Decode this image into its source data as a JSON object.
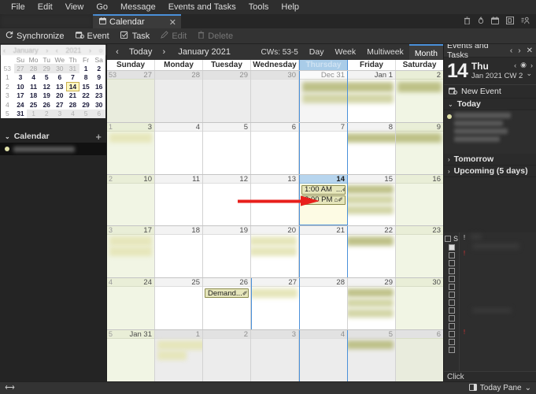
{
  "menubar": {
    "items": [
      {
        "label": "File"
      },
      {
        "label": "Edit"
      },
      {
        "label": "View"
      },
      {
        "label": "Go"
      },
      {
        "label": "Message"
      },
      {
        "label": "Events and Tasks"
      },
      {
        "label": "Tools"
      },
      {
        "label": "Help"
      }
    ]
  },
  "tabbar": {
    "tab_label": "Calendar",
    "tab_icon": "calendar-icon",
    "close_label": "✕",
    "icons": [
      "trash-icon",
      "fire-icon",
      "calendar-icon",
      "calendar-box-icon",
      "contacts-icon"
    ]
  },
  "toolbar": {
    "synchronize": "Synchronize",
    "event": "Event",
    "task": "Task",
    "edit": "Edit",
    "delete": "Delete"
  },
  "minicalendar": {
    "header_prev": "‹",
    "header_month": "January",
    "header_next": "›",
    "header_prev_y": "‹",
    "header_year": "2021",
    "header_next_y": "›",
    "header_dot": "○",
    "weekday_headers": [
      "Su",
      "Mo",
      "Tu",
      "We",
      "Th",
      "Fr",
      "Sa"
    ],
    "rows": [
      {
        "week": "53",
        "days": [
          {
            "n": "27",
            "o": true
          },
          {
            "n": "28",
            "o": true
          },
          {
            "n": "29",
            "o": true
          },
          {
            "n": "30",
            "o": true
          },
          {
            "n": "31",
            "o": true
          },
          {
            "n": "1"
          },
          {
            "n": "2"
          }
        ],
        "offmonth": true
      },
      {
        "week": "1",
        "days": [
          {
            "n": "3"
          },
          {
            "n": "4"
          },
          {
            "n": "5"
          },
          {
            "n": "6"
          },
          {
            "n": "7"
          },
          {
            "n": "8"
          },
          {
            "n": "9"
          }
        ]
      },
      {
        "week": "2",
        "days": [
          {
            "n": "10"
          },
          {
            "n": "11"
          },
          {
            "n": "12"
          },
          {
            "n": "13"
          },
          {
            "n": "14",
            "today": true
          },
          {
            "n": "15"
          },
          {
            "n": "16"
          }
        ]
      },
      {
        "week": "3",
        "days": [
          {
            "n": "17"
          },
          {
            "n": "18"
          },
          {
            "n": "19"
          },
          {
            "n": "20"
          },
          {
            "n": "21"
          },
          {
            "n": "22"
          },
          {
            "n": "23"
          }
        ]
      },
      {
        "week": "4",
        "days": [
          {
            "n": "24"
          },
          {
            "n": "25"
          },
          {
            "n": "26"
          },
          {
            "n": "27"
          },
          {
            "n": "28"
          },
          {
            "n": "29"
          },
          {
            "n": "30"
          }
        ]
      },
      {
        "week": "5",
        "days": [
          {
            "n": "31"
          },
          {
            "n": "1",
            "o": true
          },
          {
            "n": "2",
            "o": true
          },
          {
            "n": "3",
            "o": true
          },
          {
            "n": "4",
            "o": true
          },
          {
            "n": "5",
            "o": true
          },
          {
            "n": "6",
            "o": true
          }
        ],
        "tailoff": true
      }
    ]
  },
  "sidebar": {
    "calendar_section_label": "Calendar",
    "add_label": "+",
    "collapse_caret": "⌄"
  },
  "calendar": {
    "prev": "‹",
    "today_label": "Today",
    "next": "›",
    "month_label": "January 2021",
    "cws_label": "CWs: 53-5",
    "views": [
      {
        "label": "Day",
        "active": false
      },
      {
        "label": "Week",
        "active": false
      },
      {
        "label": "Multiweek",
        "active": false
      },
      {
        "label": "Month",
        "active": true
      }
    ],
    "day_headers": [
      "Sunday",
      "Monday",
      "Tuesday",
      "Wednesday",
      "Thursday",
      "Friday",
      "Saturday"
    ],
    "selected_day_header": "Thursday",
    "weeks": [
      {
        "week": "53",
        "cells": [
          {
            "num": "27",
            "offmonth": true,
            "weekend": true
          },
          {
            "num": "28",
            "offmonth": true
          },
          {
            "num": "29",
            "offmonth": true
          },
          {
            "num": "30",
            "offmonth": true
          },
          {
            "num": "Dec 31",
            "offmonth": true,
            "selcol": true
          },
          {
            "num": "Jan 1"
          },
          {
            "num": "2",
            "weekend": true
          }
        ]
      },
      {
        "week": "1",
        "cells": [
          {
            "num": "3",
            "weekend": true
          },
          {
            "num": "4"
          },
          {
            "num": "5"
          },
          {
            "num": "6"
          },
          {
            "num": "7",
            "selcol": true
          },
          {
            "num": "8"
          },
          {
            "num": "9",
            "weekend": true
          }
        ]
      },
      {
        "week": "2",
        "cells": [
          {
            "num": "10",
            "weekend": true
          },
          {
            "num": "11"
          },
          {
            "num": "12"
          },
          {
            "num": "13"
          },
          {
            "num": "14",
            "selected": true,
            "events": [
              {
                "time": "1:00 AM",
                "title": "...",
                "icons": "✐"
              },
              {
                "time": "8:00 PM",
                "title": "",
                "icons": "⌂✐"
              }
            ]
          },
          {
            "num": "15"
          },
          {
            "num": "16",
            "weekend": true
          }
        ]
      },
      {
        "week": "3",
        "cells": [
          {
            "num": "17",
            "weekend": true
          },
          {
            "num": "18"
          },
          {
            "num": "19"
          },
          {
            "num": "20"
          },
          {
            "num": "21",
            "selcol": true
          },
          {
            "num": "22"
          },
          {
            "num": "23",
            "weekend": true
          }
        ]
      },
      {
        "week": "4",
        "cells": [
          {
            "num": "24",
            "weekend": true
          },
          {
            "num": "25"
          },
          {
            "num": "26",
            "events": [
              {
                "time": "Demand...",
                "title": "",
                "icons": "✐"
              }
            ]
          },
          {
            "num": "27",
            "selcol": true
          },
          {
            "num": "28"
          },
          {
            "num": "29"
          },
          {
            "num": "30",
            "weekend": true
          }
        ]
      },
      {
        "week": "5",
        "cells": [
          {
            "num": "Jan 31",
            "weekend": true
          },
          {
            "num": "1",
            "offmonth": true
          },
          {
            "num": "2",
            "offmonth": true
          },
          {
            "num": "3",
            "offmonth": true
          },
          {
            "num": "4",
            "offmonth": true,
            "selcol": true
          },
          {
            "num": "5",
            "offmonth": true
          },
          {
            "num": "6",
            "offmonth": true,
            "weekend": true
          }
        ]
      }
    ]
  },
  "todaypane": {
    "title": "Events and Tasks",
    "prev": "‹",
    "next": "›",
    "close": "✕",
    "day_number": "14",
    "day_of_week": "Thu",
    "date_sub": "Jan 2021  CW 2",
    "mini_prev": "‹",
    "mini_dot": "◉",
    "mini_next": "›",
    "expand_caret": "⌄",
    "new_event": "New Event",
    "new_event_icon": "new-event-icon",
    "sections": [
      {
        "label": "Today",
        "caret": "⌄",
        "expanded": true
      },
      {
        "label": "Tomorrow",
        "caret": "›",
        "expanded": false
      },
      {
        "label": "Upcoming (5 days)",
        "caret": "›",
        "expanded": false
      }
    ],
    "task_header_label": "S",
    "task_priority_mark": "!",
    "click_label": "Click"
  },
  "statusbar": {
    "left_icon": "connection-icon",
    "today_pane_label": "Today Pane",
    "today_pane_icon": "today-pane-icon",
    "today_pane_caret": "⌄"
  },
  "annotation": {
    "arrow_color": "#e8201c",
    "name": "red-arrow-pointer"
  }
}
